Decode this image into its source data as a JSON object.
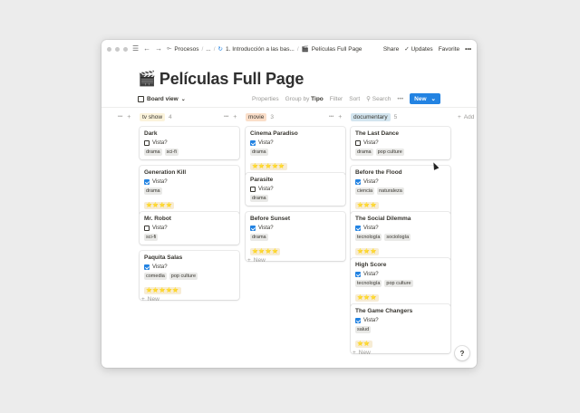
{
  "topbar": {
    "breadcrumbs": [
      "Procesos",
      "...",
      "1. Introducción a las bas...",
      "Películas Full Page"
    ],
    "share": "Share",
    "updates": "Updates",
    "favorite": "Favorite",
    "more": "•••"
  },
  "page": {
    "title_icon": "🎬",
    "title": "Películas Full Page"
  },
  "viewbar": {
    "view_label": "Board view",
    "properties": "Properties",
    "group_by": "Group by",
    "group_value": "Tipo",
    "filter": "Filter",
    "sort": "Sort",
    "search": "Search",
    "more": "•••",
    "new": "New"
  },
  "columns": [
    {
      "name": "tv show",
      "count": "4",
      "color": "#fbf3db",
      "cards": [
        {
          "title": "Dark",
          "checked": false,
          "tags": [
            "drama",
            "sci-fi"
          ],
          "stars": ""
        },
        {
          "title": "Generation Kill",
          "checked": true,
          "tags": [
            "drama"
          ],
          "stars": "⭐⭐⭐⭐"
        },
        {
          "title": "Mr. Robot",
          "checked": false,
          "tags": [
            "sci-fi"
          ],
          "stars": ""
        },
        {
          "title": "Paquita Salas",
          "checked": true,
          "tags": [
            "comedia",
            "pop culture"
          ],
          "stars": "⭐⭐⭐⭐⭐"
        }
      ]
    },
    {
      "name": "movie",
      "count": "3",
      "color": "#fadec9",
      "cards": [
        {
          "title": "Cinema Paradiso",
          "checked": true,
          "tags": [
            "drama"
          ],
          "stars": "⭐⭐⭐⭐⭐"
        },
        {
          "title": "Parasite",
          "checked": false,
          "tags": [
            "drama"
          ],
          "stars": ""
        },
        {
          "title": "Before Sunset",
          "checked": true,
          "tags": [
            "drama"
          ],
          "stars": "⭐⭐⭐⭐"
        }
      ]
    },
    {
      "name": "documentary",
      "count": "5",
      "color": "#d3e5ef",
      "cards": [
        {
          "title": "The Last Dance",
          "checked": false,
          "tags": [
            "drama",
            "pop culture"
          ],
          "stars": ""
        },
        {
          "title": "Before the Flood",
          "checked": true,
          "tags": [
            "ciencia",
            "naturaleza"
          ],
          "stars": "⭐⭐⭐"
        },
        {
          "title": "The Social Dilemma",
          "checked": true,
          "tags": [
            "tecnología",
            "sociología"
          ],
          "stars": "⭐⭐⭐"
        },
        {
          "title": "High Score",
          "checked": true,
          "tags": [
            "tecnología",
            "pop culture"
          ],
          "stars": "⭐⭐⭐"
        },
        {
          "title": "The Game Changers",
          "checked": true,
          "tags": [
            "salud"
          ],
          "stars": "⭐⭐"
        }
      ]
    }
  ],
  "labels": {
    "check_label": "Vista?",
    "new_row": "New",
    "add_group": "Add",
    "help": "?"
  }
}
